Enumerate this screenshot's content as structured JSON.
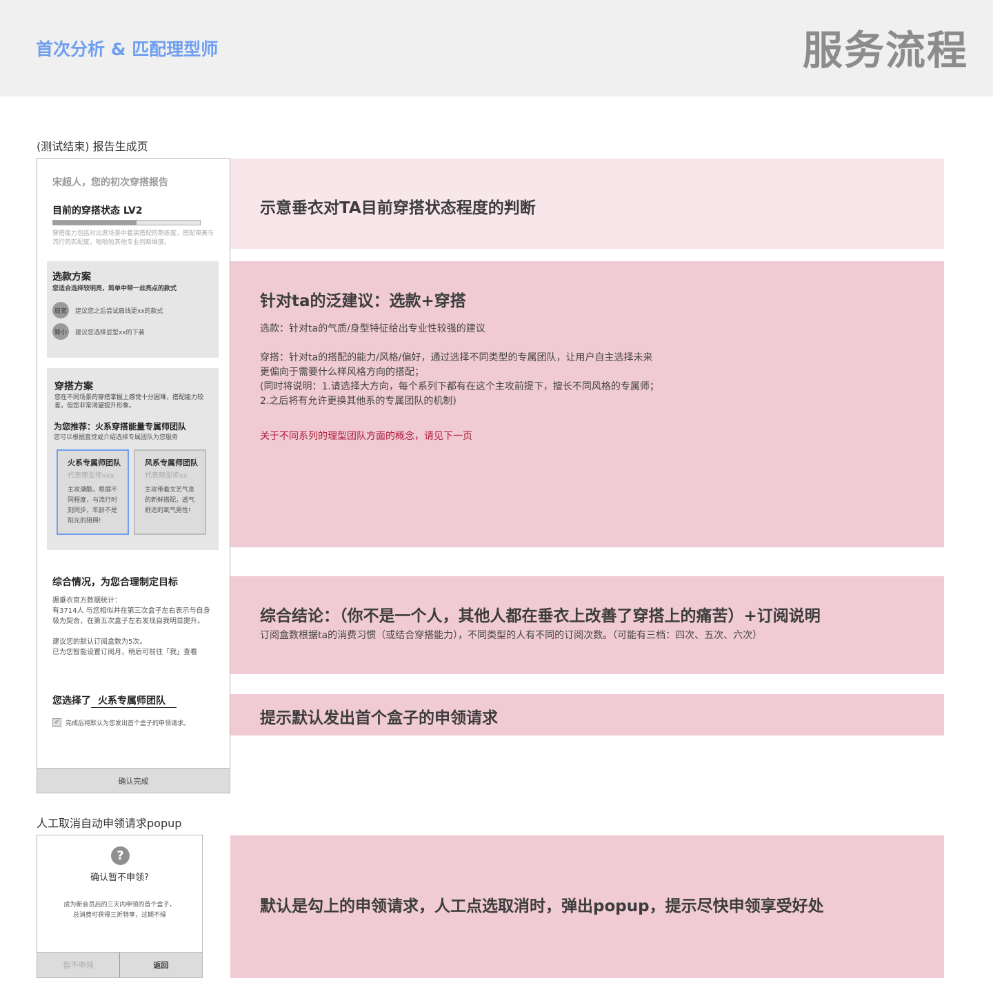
{
  "header": {
    "subtitle": "首次分析 & 匹配理型师",
    "title": "服务流程"
  },
  "sections": {
    "report_label": "(测试结束) 报告生成页",
    "popup_label": "人工取消自动申领请求popup"
  },
  "report": {
    "greeting": "宋超人，您的初次穿搭报告",
    "status_title": "目前的穿搭状态  LV2",
    "status_level": 0.57,
    "status_desc": "穿搭能力包括对出席场景中着装搭配的熟练度，搭配审美与流行的匹配度，啦啦啦其他专业判断维度。",
    "style_plan": {
      "title": "选款方案",
      "subtitle": "您适合选择较明亮，简单中带一丝亮点的款式",
      "tips": [
        {
          "tag": "肩宽",
          "text": "建议您之后尝试肩线更xx的款式"
        },
        {
          "tag": "臀小",
          "text": "建议您选择显型xx的下装"
        }
      ]
    },
    "outfit_plan": {
      "title": "穿搭方案",
      "subtitle": "您在不同场景的穿搭掌握上感觉十分困难，搭配能力较差，但您非常渴望提升形象。",
      "rec_title": "为您推荐：火系穿搭能量专属师团队",
      "rec_sub": "您可以根据直觉或介绍选择专属团队为您服务",
      "teams": [
        {
          "name": "火系专属师团队",
          "stylist": "代表理型师xxx",
          "desc": "主攻潮酷，根据不同程度，与流行时刻同步，年龄不是阳光的阻碍!"
        },
        {
          "name": "风系专属师团队",
          "stylist": "代表理型师xx",
          "desc": "主攻带着文艺气息的新鲜搭配，透气舒适的氧气男性!"
        }
      ]
    },
    "summary": {
      "title": "综合情况，为您合理制定目标",
      "text": "据垂衣官方数据统计：\n有3714人 与您相似并在第三次盒子左右表示与自身极为契合，在第五次盒子左右发现自我明显提升。\n\n建议您的默认订阅盒数为5次。\n已为您智能设置订阅月，稍后可前往「我」查看"
    },
    "choice_prefix": "您选择了",
    "choice_team": "火系专属师团队",
    "checkbox_label": "完成后将默认为您发出首个盒子的申领请求。",
    "confirm_button": "确认完成"
  },
  "notes": {
    "n1": {
      "title": "示意垂衣对TA目前穿搭状态程度的判断"
    },
    "n2": {
      "title": "针对ta的泛建议：选款+穿搭",
      "p1": "选款：针对ta的气质/身型特征给出专业性较强的建议",
      "p2": "穿搭：针对ta的搭配的能力/风格/偏好，通过选择不同类型的专属团队，让用户自主选择未来\n更偏向于需要什么样风格方向的搭配；\n(同时将说明：1.请选择大方向，每个系列下都有在这个主攻前提下，擅长不同风格的专属师；\n2.之后将有允许更换其他系的专属团队的机制)",
      "red": "关于不同系列的理型团队方面的概念，请见下一页"
    },
    "n3": {
      "title": "综合结论：（你不是一个人，其他人都在垂衣上改善了穿搭上的痛苦）+订阅说明",
      "p": "订阅盒数根据ta的消费习惯（或结合穿搭能力），不同类型的人有不同的订阅次数。（可能有三档：四次、五次、六次）"
    },
    "n4": {
      "title": "提示默认发出首个盒子的申领请求"
    },
    "n5": {
      "title": "默认是勾上的申领请求，人工点选取消时，弹出popup，提示尽快申领享受好处"
    }
  },
  "popup": {
    "icon": "question-icon",
    "icon_glyph": "?",
    "title": "确认暂不申领?",
    "body": "成为新会员后的三天内申领的首个盒子，\n总消费可获得三折特享，过期不候",
    "cancel_button": "暂不申领",
    "back_button": "返回"
  },
  "colors": {
    "accent_blue": "#6f9ef0",
    "note_light": "#f7e6ea",
    "note_pink": "#f0cbd4",
    "note_red": "#b01a38"
  }
}
